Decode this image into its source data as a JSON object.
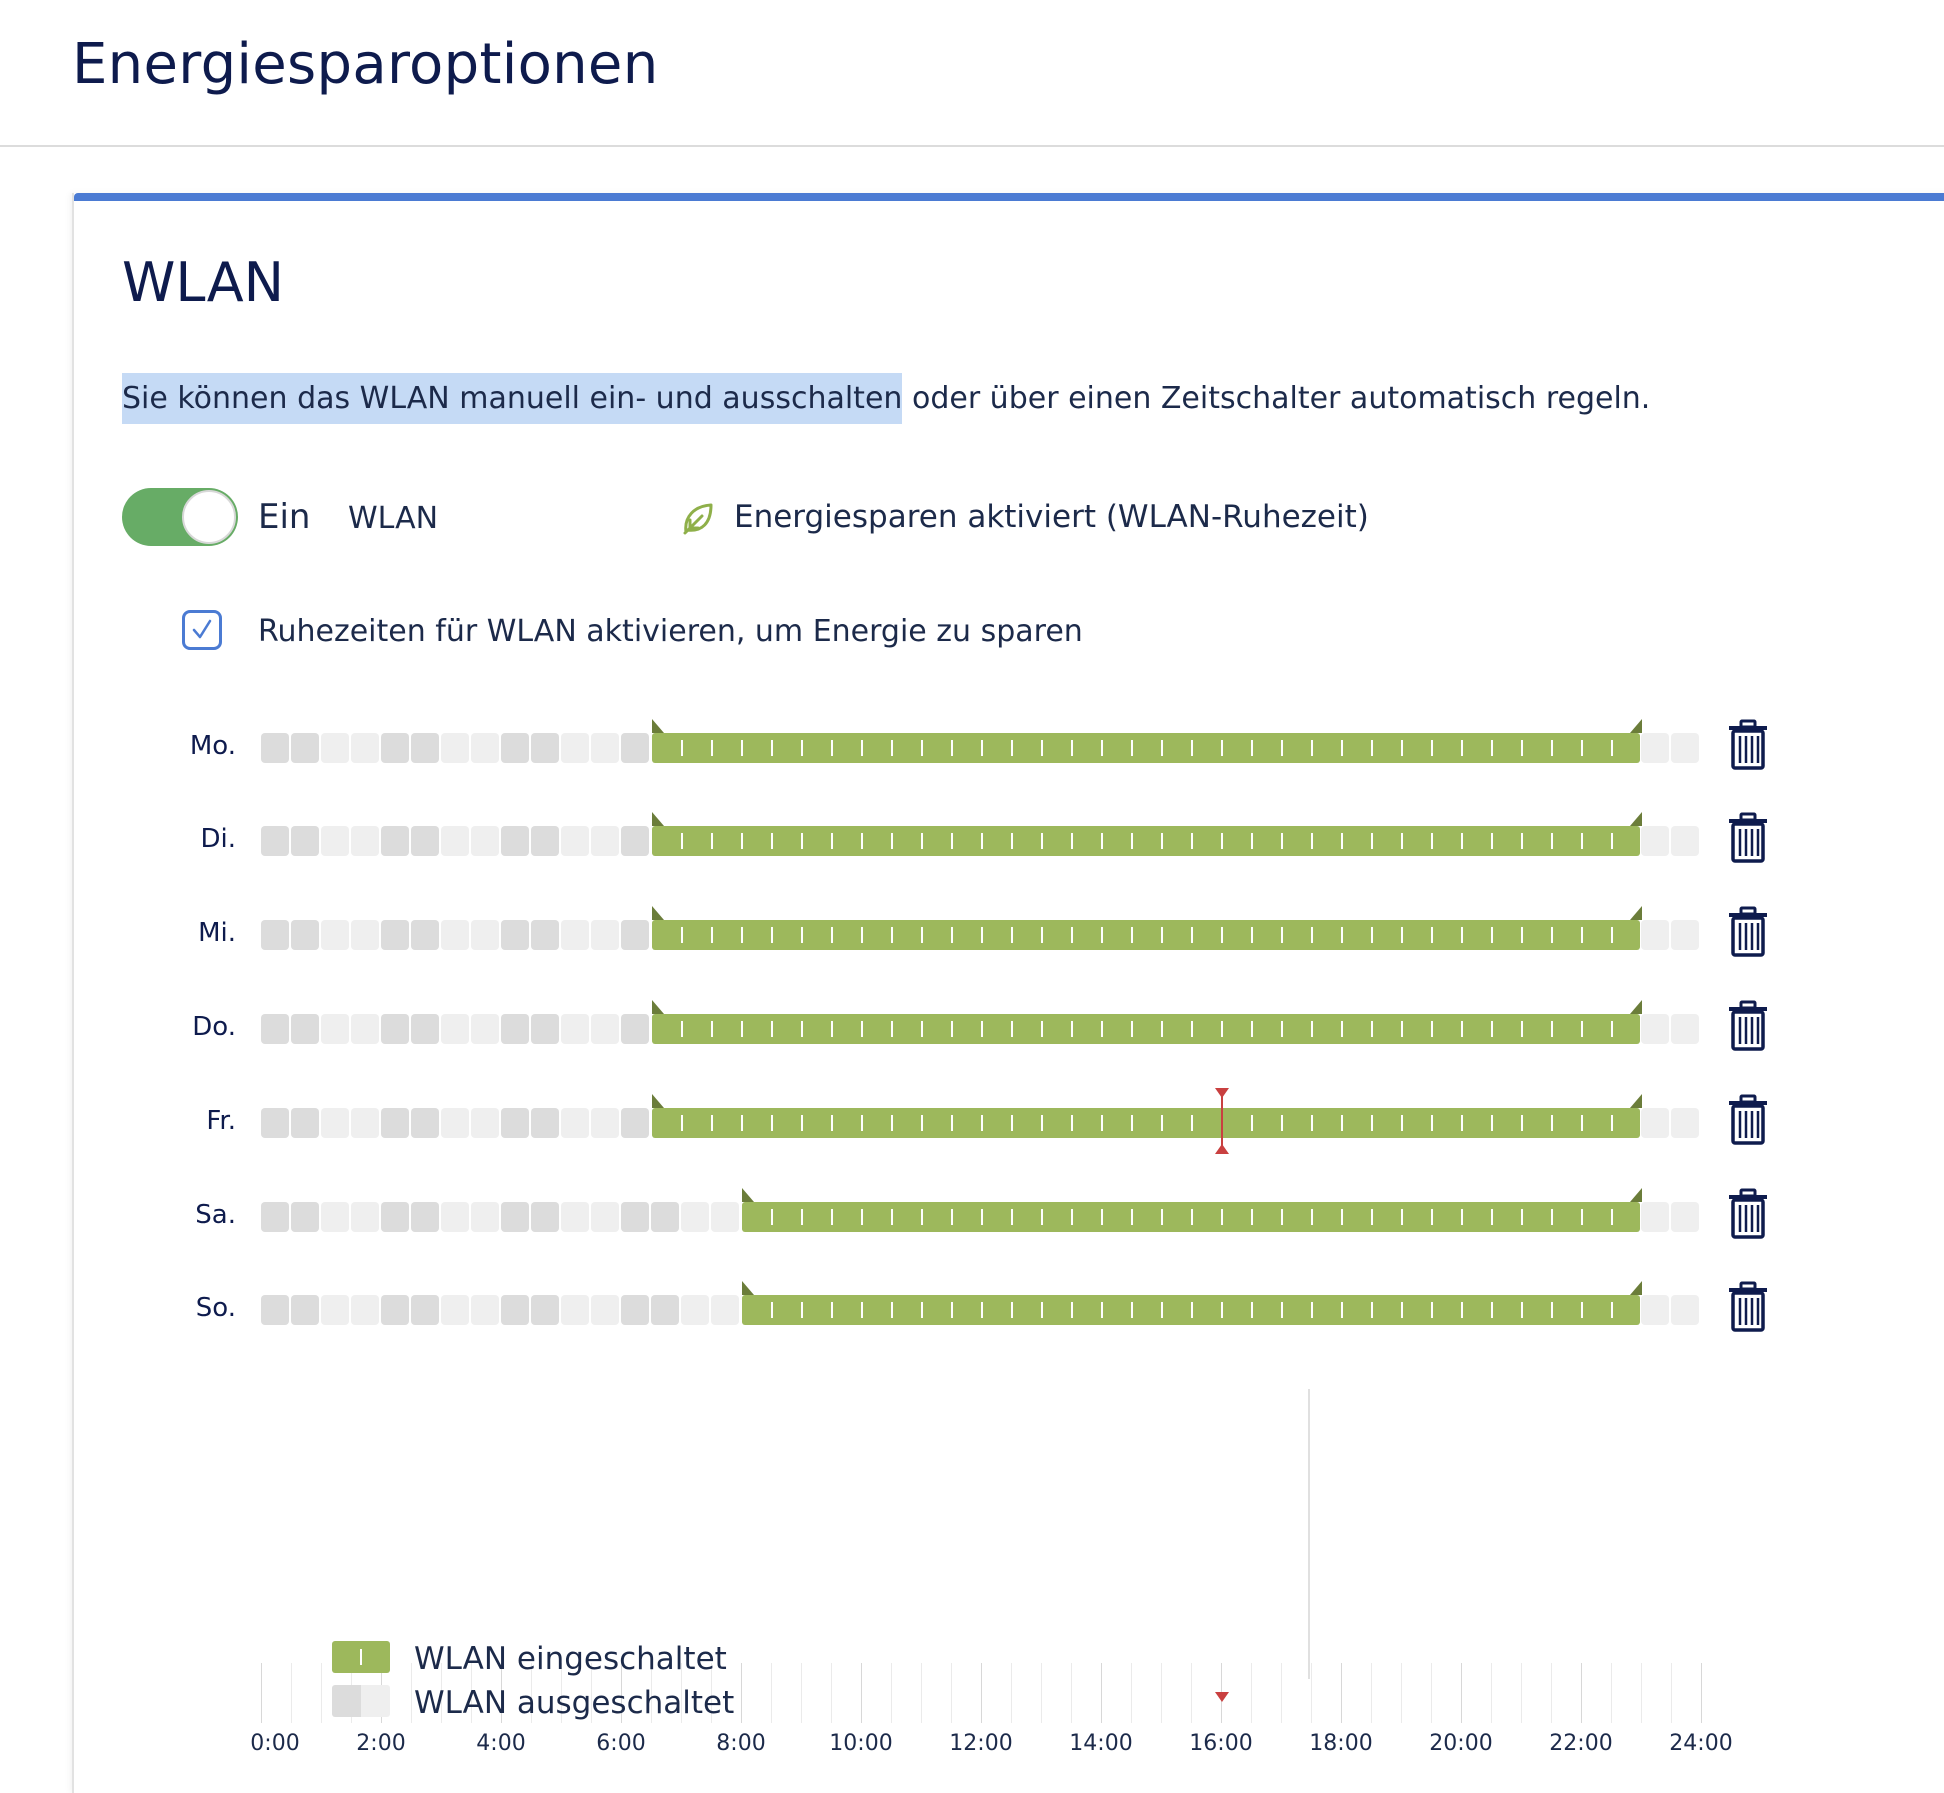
{
  "page": {
    "title": "Energiesparoptionen"
  },
  "wlan_card": {
    "title": "WLAN",
    "intro_highlighted": "Sie können das WLAN manuell ein- und ausschalten",
    "intro_rest": " oder über einen Zeitschalter automatisch regeln.",
    "toggle": {
      "state_label": "Ein",
      "name": "WLAN",
      "checked": true
    },
    "eco_status": {
      "icon": "leaf-icon",
      "text": "Energiesparen aktiviert (WLAN-Ruhezeit)"
    },
    "rest_times_checkbox": {
      "label": "Ruhezeiten für WLAN aktivieren, um Energie zu sparen",
      "checked": true
    },
    "schedule": {
      "days": [
        {
          "label": "Mo.",
          "on_from": "6:30",
          "on_to": "23:00"
        },
        {
          "label": "Di.",
          "on_from": "6:30",
          "on_to": "23:00"
        },
        {
          "label": "Mi.",
          "on_from": "6:30",
          "on_to": "23:00"
        },
        {
          "label": "Do.",
          "on_from": "6:30",
          "on_to": "23:00"
        },
        {
          "label": "Fr.",
          "on_from": "6:30",
          "on_to": "23:00"
        },
        {
          "label": "Sa.",
          "on_from": "8:00",
          "on_to": "23:00"
        },
        {
          "label": "So.",
          "on_from": "8:00",
          "on_to": "23:00"
        }
      ],
      "current_time": "16:00",
      "current_day": "Fr.",
      "axis_labels": [
        "0:00",
        "2:00",
        "4:00",
        "6:00",
        "8:00",
        "10:00",
        "12:00",
        "14:00",
        "16:00",
        "18:00",
        "20:00",
        "22:00",
        "24:00"
      ],
      "delete_icon": "trash-icon"
    },
    "legend": [
      {
        "label": "WLAN eingeschaltet",
        "color": "#9db85c"
      },
      {
        "label": "WLAN ausgeschaltet",
        "color": "#dcdcdc"
      }
    ],
    "colors": {
      "accent": "#4b7bd3",
      "toggle_on": "#67ac66",
      "on_bar": "#9db85c",
      "handle": "#6b7d3a",
      "now_marker": "#c94040",
      "text_dark": "#0e1b4d"
    }
  }
}
